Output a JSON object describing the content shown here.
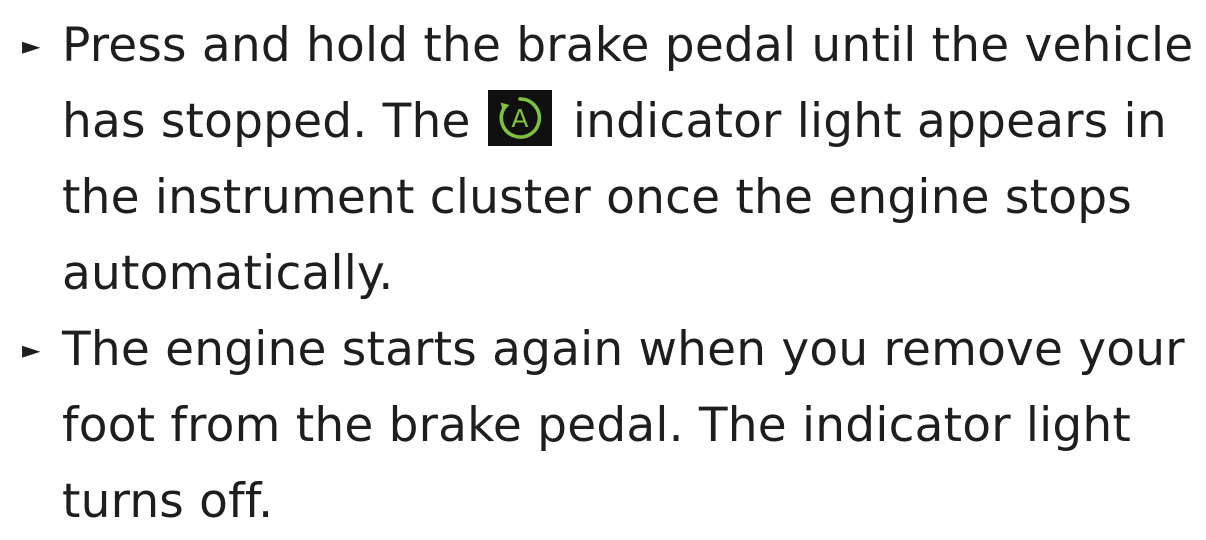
{
  "steps": [
    {
      "bullet": "►",
      "lines": [
        "Press and hold the brake pedal until the vehicle",
        [
          "has stopped. The",
          "indicator light appears in"
        ],
        "the instrument cluster once the engine stops",
        "automatically."
      ]
    },
    {
      "bullet": "►",
      "lines": [
        "The engine starts again when you remove your",
        "foot from the brake pedal. The indicator light",
        "turns off."
      ]
    }
  ],
  "indicator_icon": {
    "name": "auto-start-stop-icon",
    "letter": "A",
    "color": "#7dc241",
    "background": "#101010"
  }
}
